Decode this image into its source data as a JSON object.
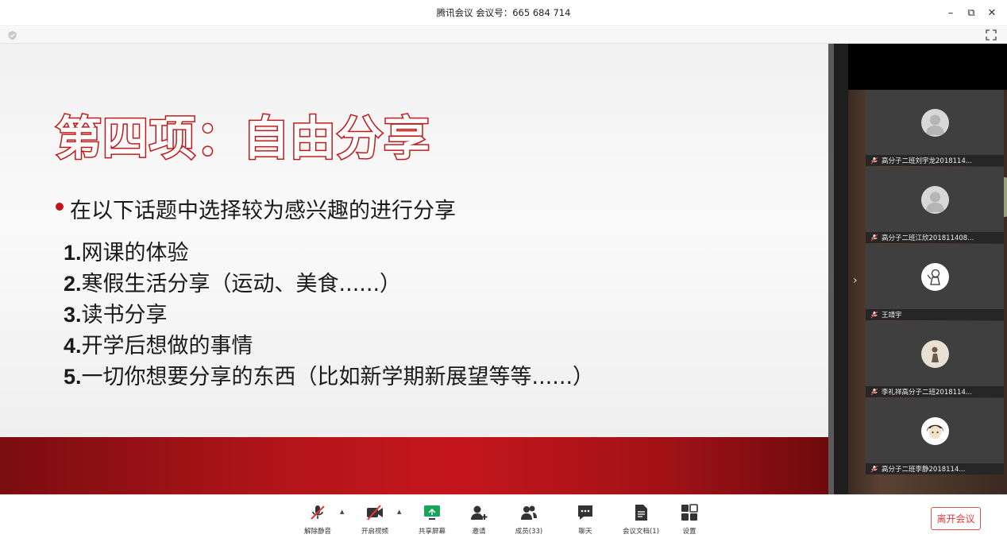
{
  "window": {
    "title": "腾讯会议 会议号：665 684 714",
    "minimize_icon": "–",
    "restore_icon": "⧉",
    "close_icon": "✕"
  },
  "slide": {
    "title": "第四项：自由分享",
    "bullet": "在以下话题中选择较为感兴趣的进行分享",
    "topics": [
      {
        "num": "1.",
        "text": "网课的体验"
      },
      {
        "num": "2.",
        "text": "寒假生活分享（运动、美食......）"
      },
      {
        "num": "3.",
        "text": "读书分享"
      },
      {
        "num": "4.",
        "text": "开学后想做的事情"
      },
      {
        "num": "5.",
        "text": "一切你想要分享的东西（比如新学期新展望等等......）"
      }
    ],
    "accent_color": "#c0161b"
  },
  "participants": [
    {
      "name": "高分子二班刘宇龙2018114...",
      "avatar": "default-avatar-icon"
    },
    {
      "name": "高分子二班江欣201811408...",
      "avatar": "default-avatar-icon"
    },
    {
      "name": "王靖宇",
      "avatar": "astronaut-avatar-icon"
    },
    {
      "name": "李礼祥高分子二班2018114...",
      "avatar": "figure-avatar-icon"
    },
    {
      "name": "高分子二班李静2018114...",
      "avatar": "cartoon-avatar-icon"
    }
  ],
  "toolbar": {
    "unmute": "解除静音",
    "start_video": "开启视频",
    "share_screen": "共享屏幕",
    "invite": "邀请",
    "members": "成员(33)",
    "chat": "聊天",
    "documents": "会议文档(1)",
    "settings": "设置",
    "leave": "离开会议"
  }
}
